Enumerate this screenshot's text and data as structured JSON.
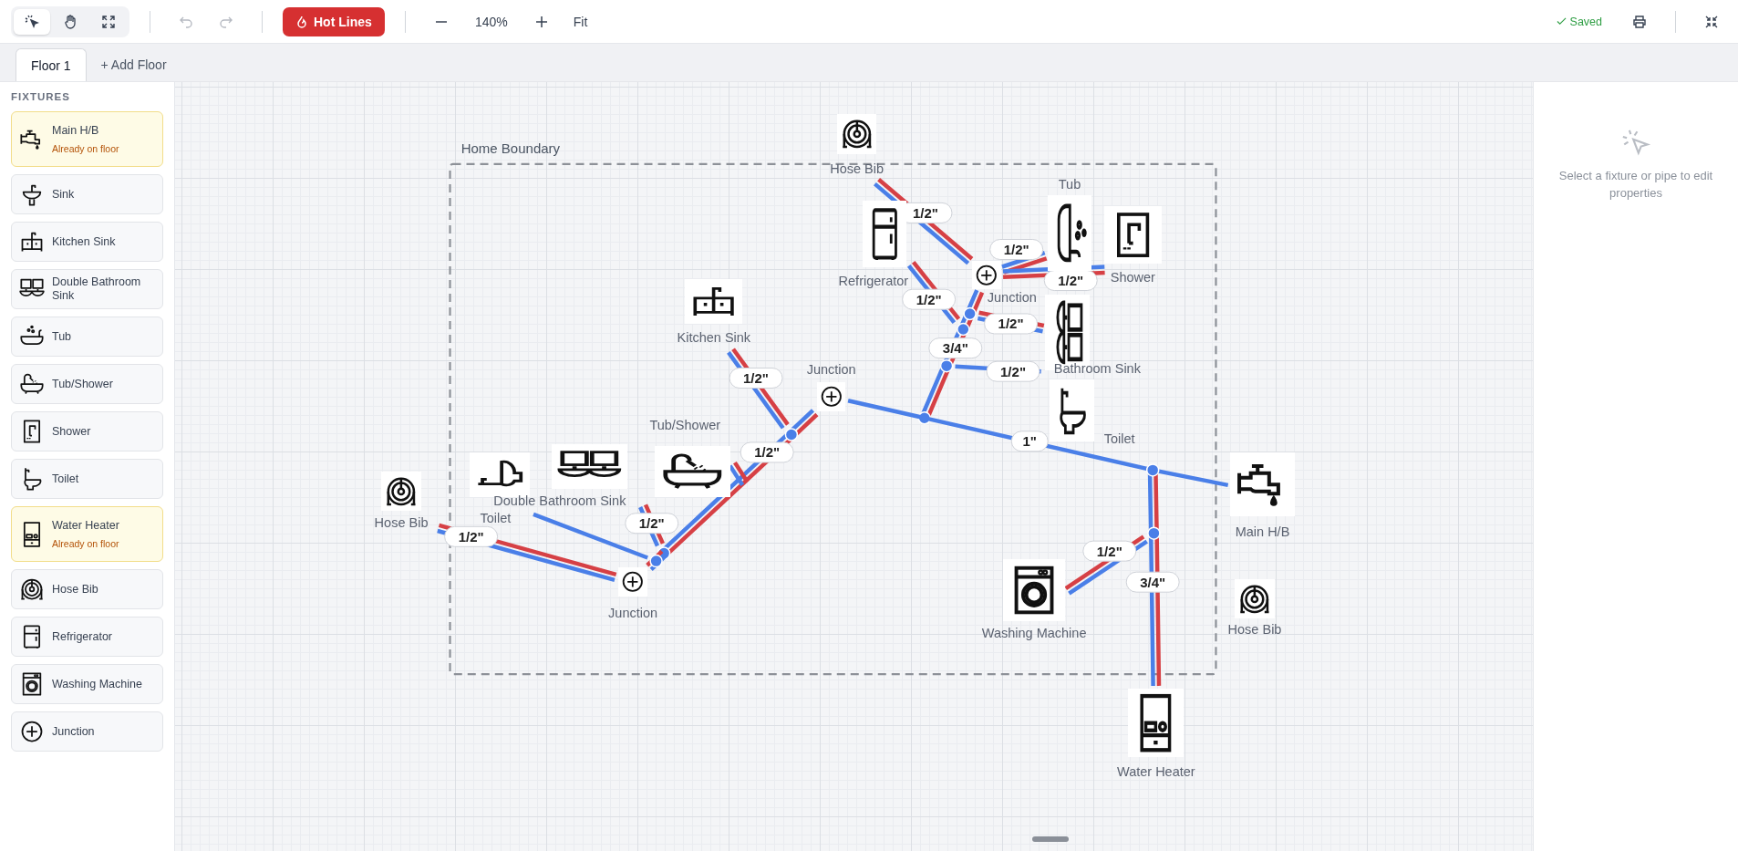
{
  "toolbar": {
    "tools": [
      {
        "kind": "select",
        "selected": true
      },
      {
        "kind": "pan",
        "selected": false
      },
      {
        "kind": "fit",
        "selected": false
      }
    ],
    "history": [
      {
        "kind": "undo",
        "disabled": true
      },
      {
        "kind": "redo",
        "disabled": true
      }
    ],
    "hot_lines": {
      "label": "Hot Lines",
      "on": true
    },
    "zoom": "140%",
    "fit": "Fit",
    "status": "Saved"
  },
  "tabs": [
    {
      "label": "Floor 1",
      "selected": true
    }
  ],
  "add_floor": "+ Add Floor",
  "sidebar": {
    "title": "FIXTURES",
    "items": [
      {
        "label": "Main H/B",
        "kind": "faucet",
        "placed": true,
        "note": "Already on floor"
      },
      {
        "label": "Sink",
        "kind": "sink",
        "placed": false
      },
      {
        "label": "Kitchen Sink",
        "kind": "kitchen_sink",
        "placed": false
      },
      {
        "label": "Double Bathroom Sink",
        "kind": "double_sink",
        "placed": false
      },
      {
        "label": "Tub",
        "kind": "tub",
        "placed": false
      },
      {
        "label": "Tub/Shower",
        "kind": "tub_shower",
        "placed": false
      },
      {
        "label": "Shower",
        "kind": "shower",
        "placed": false
      },
      {
        "label": "Toilet",
        "kind": "toilet",
        "placed": false
      },
      {
        "label": "Water Heater",
        "kind": "water_heater",
        "placed": true,
        "note": "Already on floor"
      },
      {
        "label": "Hose Bib",
        "kind": "hose_bib",
        "placed": false
      },
      {
        "label": "Refrigerator",
        "kind": "refrigerator",
        "placed": false
      },
      {
        "label": "Washing Machine",
        "kind": "washer",
        "placed": false
      },
      {
        "label": "Junction",
        "kind": "junction",
        "placed": false
      }
    ]
  },
  "canvas": {
    "boundary_label": "Home Boundary",
    "fixtures": [
      {
        "label": "Hose Bib",
        "kind": "hose_bib"
      },
      {
        "label": "Refrigerator",
        "kind": "refrigerator"
      },
      {
        "label": "Tub",
        "kind": "tub"
      },
      {
        "label": "Shower",
        "kind": "shower"
      },
      {
        "label": "Junction",
        "kind": "junction"
      },
      {
        "label": "Bathroom Sink",
        "kind": "double_sink"
      },
      {
        "label": "Kitchen Sink",
        "kind": "kitchen_sink"
      },
      {
        "label": "Junction",
        "kind": "junction"
      },
      {
        "label": "Toilet",
        "kind": "toilet"
      },
      {
        "label": "Main H/B",
        "kind": "faucet"
      },
      {
        "label": "Washing Machine",
        "kind": "washer"
      },
      {
        "label": "Hose Bib",
        "kind": "hose_bib"
      },
      {
        "label": "Water Heater",
        "kind": "water_heater"
      },
      {
        "label": "Hose Bib",
        "kind": "hose_bib"
      },
      {
        "label": "Toilet",
        "kind": "toilet"
      },
      {
        "label": "Double Bathroom Sink",
        "kind": "double_sink"
      },
      {
        "label": "Tub/Shower",
        "kind": "tub_shower"
      },
      {
        "label": "Junction",
        "kind": "junction"
      }
    ],
    "pipes": [
      {
        "size": "1/2\"",
        "hot": true
      },
      {
        "size": "1/2\"",
        "hot": true
      },
      {
        "size": "1/2\"",
        "hot": true
      },
      {
        "size": "1/2\"",
        "hot": true
      },
      {
        "size": "3/4\"",
        "hot": true
      },
      {
        "size": "1/2\"",
        "hot": true
      },
      {
        "size": "1/2\"",
        "hot": false
      },
      {
        "size": "1\"",
        "hot": false
      },
      {
        "size": "1/2\"",
        "hot": true
      },
      {
        "hot": true
      },
      {
        "size": "1/2\"",
        "hot": true
      },
      {
        "size": "1/2\"",
        "hot": true
      },
      {
        "hot": false
      },
      {
        "size": "1/2\"",
        "hot": true
      },
      {
        "hot": true
      },
      {
        "size": "1/2\"",
        "hot": true
      },
      {
        "size": "3/4\"",
        "hot": true
      }
    ]
  },
  "properties": {
    "hint": "Select a fixture or pipe to edit properties"
  }
}
